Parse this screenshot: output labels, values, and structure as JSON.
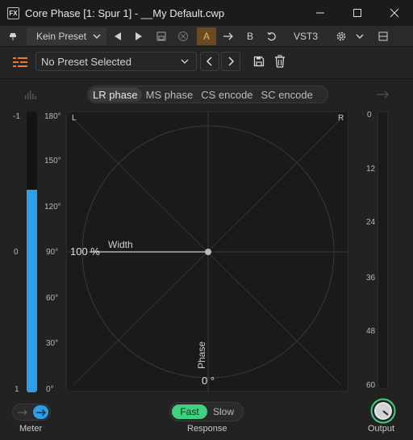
{
  "window": {
    "icon_text": "FX",
    "title": "Core Phase [1: Spur 1] - __My Default.cwp"
  },
  "host_toolbar": {
    "preset_label": "Kein Preset",
    "a_label": "A",
    "b_label": "B",
    "vst_label": "VST3"
  },
  "plugin_header": {
    "preset_value": "No Preset Selected"
  },
  "tabs": [
    {
      "label": "LR phase",
      "active": true
    },
    {
      "label": "MS phase",
      "active": false
    },
    {
      "label": "CS encode",
      "active": false
    },
    {
      "label": "SC encode",
      "active": false
    }
  ],
  "left_meter": {
    "labels": [
      "-1",
      "0",
      "1"
    ],
    "level": 0.72,
    "color": "#2f9ee8"
  },
  "phase_scale": [
    "180°",
    "150°",
    "120°",
    "90°",
    "60°",
    "30°",
    "0°"
  ],
  "scope": {
    "corner_left": "L",
    "corner_right": "R",
    "width_value": "100 %",
    "width_label": "Width",
    "phase_label": "Phase",
    "phase_value": "0 °"
  },
  "output_scale": [
    "0",
    "12",
    "24",
    "36",
    "48",
    "60"
  ],
  "meter_control": {
    "label": "Meter"
  },
  "response": {
    "label": "Response",
    "fast": "Fast",
    "slow": "Slow",
    "selected": "Fast",
    "accent": "#3fd17f"
  },
  "output": {
    "label": "Output"
  }
}
